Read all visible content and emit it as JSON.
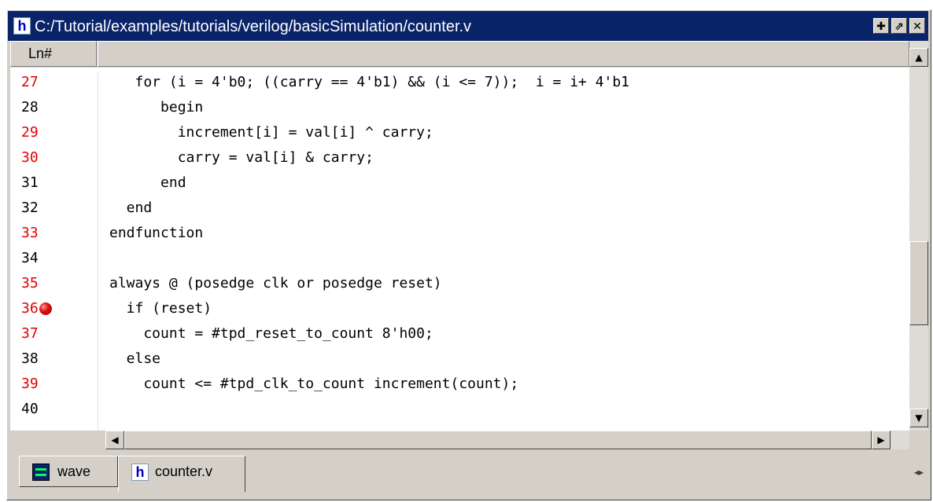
{
  "window": {
    "title": "C:/Tutorial/examples/tutorials/verilog/basicSimulation/counter.v",
    "icon": "h-file-icon",
    "buttons": [
      "dock-icon",
      "undock-icon",
      "close-icon"
    ]
  },
  "editor": {
    "ln_header": "Ln#",
    "lines": [
      {
        "num": "27",
        "red": true,
        "code": "   for (i = 4'b0; ((carry == 4'b1) && (i <= 7));  i = i+ 4'b1"
      },
      {
        "num": "28",
        "red": false,
        "code": "      begin"
      },
      {
        "num": "29",
        "red": true,
        "code": "        increment[i] = val[i] ^ carry;"
      },
      {
        "num": "30",
        "red": true,
        "code": "        carry = val[i] & carry;"
      },
      {
        "num": "31",
        "red": false,
        "code": "      end"
      },
      {
        "num": "32",
        "red": false,
        "code": "  end"
      },
      {
        "num": "33",
        "red": true,
        "code": "endfunction"
      },
      {
        "num": "34",
        "red": false,
        "code": ""
      },
      {
        "num": "35",
        "red": true,
        "code": "always @ (posedge clk or posedge reset)"
      },
      {
        "num": "36",
        "red": true,
        "code": "  if (reset)",
        "breakpoint": true
      },
      {
        "num": "37",
        "red": true,
        "code": "    count = #tpd_reset_to_count 8'h00;"
      },
      {
        "num": "38",
        "red": false,
        "code": "  else"
      },
      {
        "num": "39",
        "red": true,
        "code": "    count <= #tpd_clk_to_count increment(count);"
      },
      {
        "num": "40",
        "red": false,
        "code": ""
      }
    ]
  },
  "tabs": [
    {
      "label": "wave",
      "icon": "wave-icon",
      "active": false
    },
    {
      "label": "counter.v",
      "icon": "h-file-icon",
      "active": true
    }
  ],
  "colors": {
    "title_bg": "#0a246a",
    "line_num_red": "#e00000",
    "chrome": "#d4d0c8"
  }
}
